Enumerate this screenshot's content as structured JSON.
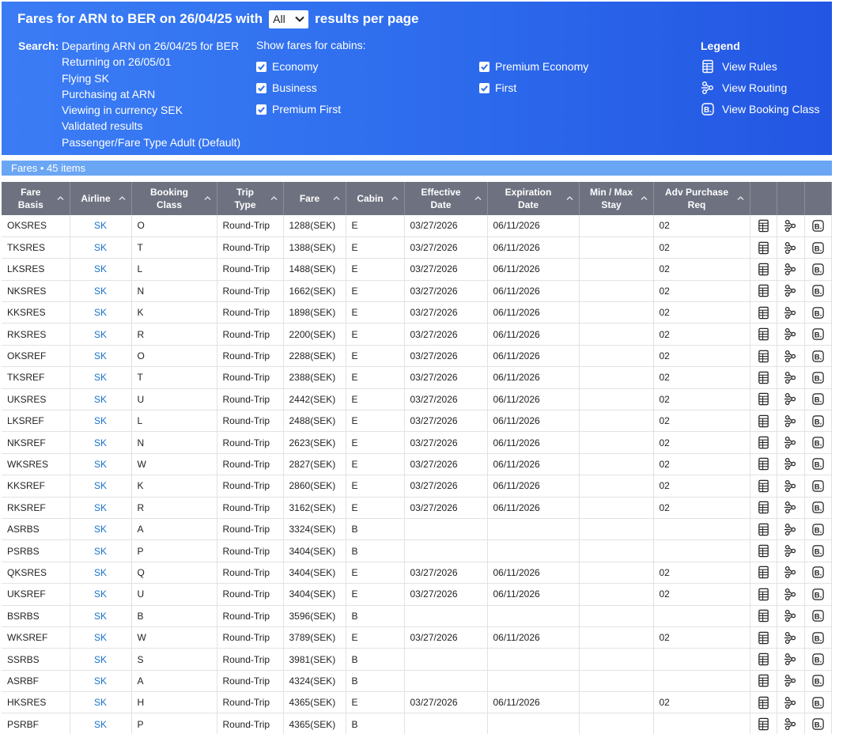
{
  "header": {
    "title_prefix": "Fares for ARN to BER on 26/04/25 with",
    "per_page_value": "All",
    "title_suffix": "results per page"
  },
  "search": {
    "label": "Search:",
    "lines": [
      "Departing ARN on 26/04/25 for BER",
      "Returning on 26/05/01",
      "Flying SK",
      "Purchasing at ARN",
      "Viewing in currency SEK",
      "Validated results",
      "Passenger/Fare Type Adult (Default)"
    ]
  },
  "cabins": {
    "label": "Show fares for cabins:",
    "items": [
      {
        "label": "Economy",
        "checked": true
      },
      {
        "label": "Premium Economy",
        "checked": true
      },
      {
        "label": "Business",
        "checked": true
      },
      {
        "label": "First",
        "checked": true
      },
      {
        "label": "Premium First",
        "checked": true
      }
    ]
  },
  "legend": {
    "title": "Legend",
    "items": [
      {
        "label": "View Rules",
        "icon": "rules-icon"
      },
      {
        "label": "View Routing",
        "icon": "routing-icon"
      },
      {
        "label": "View Booking Class",
        "icon": "booking-class-icon"
      }
    ]
  },
  "fares_bar": "Fares • 45 items",
  "table": {
    "columns": [
      {
        "line1": "Fare",
        "line2": "Basis",
        "sortable": true
      },
      {
        "line1": "Airline",
        "line2": "",
        "sortable": true
      },
      {
        "line1": "Booking",
        "line2": "Class",
        "sortable": true
      },
      {
        "line1": "Trip",
        "line2": "Type",
        "sortable": true
      },
      {
        "line1": "Fare",
        "line2": "",
        "sortable": true
      },
      {
        "line1": "Cabin",
        "line2": "",
        "sortable": true
      },
      {
        "line1": "Effective",
        "line2": "Date",
        "sortable": true
      },
      {
        "line1": "Expiration",
        "line2": "Date",
        "sortable": true
      },
      {
        "line1": "Min / Max",
        "line2": "Stay",
        "sortable": true
      },
      {
        "line1": "Adv Purchase",
        "line2": "Req",
        "sortable": true
      },
      {
        "line1": "",
        "line2": "",
        "sortable": false
      },
      {
        "line1": "",
        "line2": "",
        "sortable": false
      },
      {
        "line1": "",
        "line2": "",
        "sortable": false
      }
    ],
    "rows": [
      [
        "OKSRES",
        "SK",
        "O",
        "Round-Trip",
        "1288(SEK)",
        "E",
        "03/27/2026",
        "06/11/2026",
        "",
        "02"
      ],
      [
        "TKSRES",
        "SK",
        "T",
        "Round-Trip",
        "1388(SEK)",
        "E",
        "03/27/2026",
        "06/11/2026",
        "",
        "02"
      ],
      [
        "LKSRES",
        "SK",
        "L",
        "Round-Trip",
        "1488(SEK)",
        "E",
        "03/27/2026",
        "06/11/2026",
        "",
        "02"
      ],
      [
        "NKSRES",
        "SK",
        "N",
        "Round-Trip",
        "1662(SEK)",
        "E",
        "03/27/2026",
        "06/11/2026",
        "",
        "02"
      ],
      [
        "KKSRES",
        "SK",
        "K",
        "Round-Trip",
        "1898(SEK)",
        "E",
        "03/27/2026",
        "06/11/2026",
        "",
        "02"
      ],
      [
        "RKSRES",
        "SK",
        "R",
        "Round-Trip",
        "2200(SEK)",
        "E",
        "03/27/2026",
        "06/11/2026",
        "",
        "02"
      ],
      [
        "OKSREF",
        "SK",
        "O",
        "Round-Trip",
        "2288(SEK)",
        "E",
        "03/27/2026",
        "06/11/2026",
        "",
        "02"
      ],
      [
        "TKSREF",
        "SK",
        "T",
        "Round-Trip",
        "2388(SEK)",
        "E",
        "03/27/2026",
        "06/11/2026",
        "",
        "02"
      ],
      [
        "UKSRES",
        "SK",
        "U",
        "Round-Trip",
        "2442(SEK)",
        "E",
        "03/27/2026",
        "06/11/2026",
        "",
        "02"
      ],
      [
        "LKSREF",
        "SK",
        "L",
        "Round-Trip",
        "2488(SEK)",
        "E",
        "03/27/2026",
        "06/11/2026",
        "",
        "02"
      ],
      [
        "NKSREF",
        "SK",
        "N",
        "Round-Trip",
        "2623(SEK)",
        "E",
        "03/27/2026",
        "06/11/2026",
        "",
        "02"
      ],
      [
        "WKSRES",
        "SK",
        "W",
        "Round-Trip",
        "2827(SEK)",
        "E",
        "03/27/2026",
        "06/11/2026",
        "",
        "02"
      ],
      [
        "KKSREF",
        "SK",
        "K",
        "Round-Trip",
        "2860(SEK)",
        "E",
        "03/27/2026",
        "06/11/2026",
        "",
        "02"
      ],
      [
        "RKSREF",
        "SK",
        "R",
        "Round-Trip",
        "3162(SEK)",
        "E",
        "03/27/2026",
        "06/11/2026",
        "",
        "02"
      ],
      [
        "ASRBS",
        "SK",
        "A",
        "Round-Trip",
        "3324(SEK)",
        "B",
        "",
        "",
        "",
        ""
      ],
      [
        "PSRBS",
        "SK",
        "P",
        "Round-Trip",
        "3404(SEK)",
        "B",
        "",
        "",
        "",
        ""
      ],
      [
        "QKSRES",
        "SK",
        "Q",
        "Round-Trip",
        "3404(SEK)",
        "E",
        "03/27/2026",
        "06/11/2026",
        "",
        "02"
      ],
      [
        "UKSREF",
        "SK",
        "U",
        "Round-Trip",
        "3404(SEK)",
        "E",
        "03/27/2026",
        "06/11/2026",
        "",
        "02"
      ],
      [
        "BSRBS",
        "SK",
        "B",
        "Round-Trip",
        "3596(SEK)",
        "B",
        "",
        "",
        "",
        ""
      ],
      [
        "WKSREF",
        "SK",
        "W",
        "Round-Trip",
        "3789(SEK)",
        "E",
        "03/27/2026",
        "06/11/2026",
        "",
        "02"
      ],
      [
        "SSRBS",
        "SK",
        "S",
        "Round-Trip",
        "3981(SEK)",
        "B",
        "",
        "",
        "",
        ""
      ],
      [
        "ASRBF",
        "SK",
        "A",
        "Round-Trip",
        "4324(SEK)",
        "B",
        "",
        "",
        "",
        ""
      ],
      [
        "HKSRES",
        "SK",
        "H",
        "Round-Trip",
        "4365(SEK)",
        "E",
        "03/27/2026",
        "06/11/2026",
        "",
        "02"
      ],
      [
        "PSRBF",
        "SK",
        "P",
        "Round-Trip",
        "4365(SEK)",
        "B",
        "",
        "",
        "",
        ""
      ]
    ]
  },
  "colors": {
    "header_start": "#3b7cf5",
    "header_end": "#2356e3",
    "fares_bar": "#6ba6f5",
    "table_header": "#6e7280",
    "airline_link": "#1a73c9"
  }
}
